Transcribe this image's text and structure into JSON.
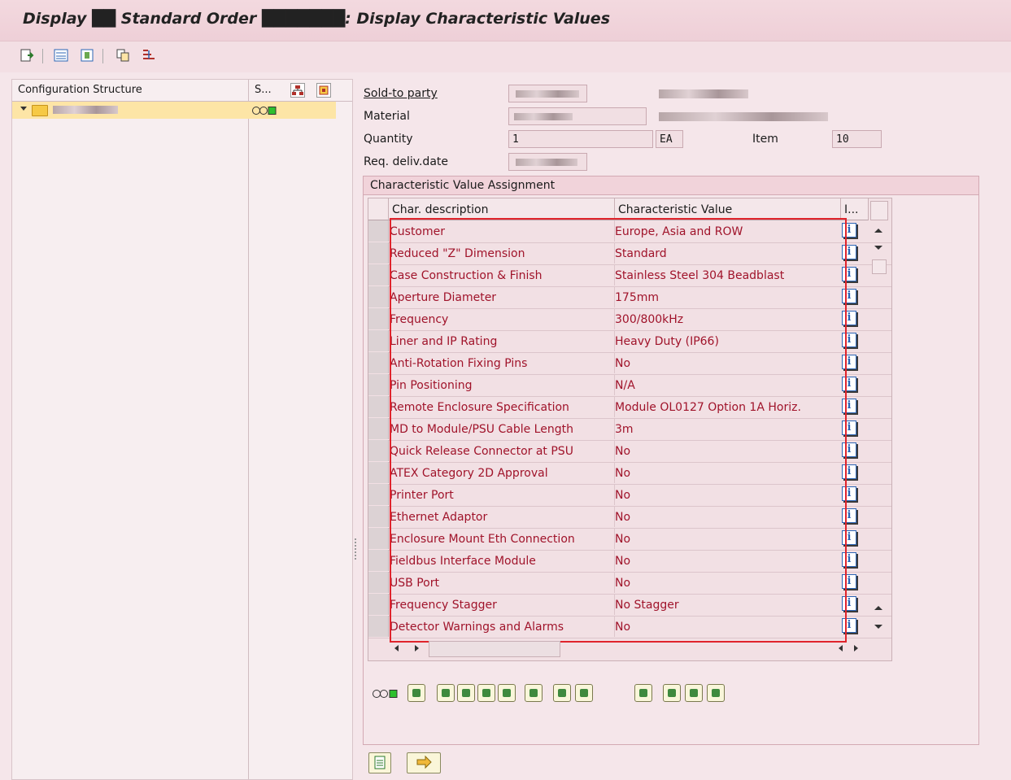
{
  "window": {
    "title": "Display ██ Standard Order ███████: Display Characteristic Values"
  },
  "toolbar": {
    "icons": [
      "new-document-icon",
      "expand-all-icon",
      "collapse-icon",
      "copy-icon",
      "hierarchy-icon"
    ]
  },
  "tree": {
    "col1": "Configuration Structure",
    "col2": "S...",
    "root_status": "OO■"
  },
  "header": {
    "sold_to_label": "Sold-to party",
    "material_label": "Material",
    "quantity_label": "Quantity",
    "quantity_value": "1",
    "uom_value": "EA",
    "item_label": "Item",
    "item_value": "10",
    "reqdate_label": "Req. deliv.date"
  },
  "group": {
    "title": "Characteristic Value Assignment"
  },
  "table": {
    "col_desc": "Char. description",
    "col_value": "Characteristic Value",
    "col_info": "I...",
    "rows": [
      {
        "desc": "Customer",
        "value": "Europe, Asia and ROW"
      },
      {
        "desc": "Reduced \"Z\" Dimension",
        "value": "Standard"
      },
      {
        "desc": "Case Construction & Finish",
        "value": "Stainless Steel 304 Beadblast"
      },
      {
        "desc": "Aperture Diameter",
        "value": "175mm"
      },
      {
        "desc": "Frequency",
        "value": "300/800kHz"
      },
      {
        "desc": "Liner and IP Rating",
        "value": "Heavy Duty (IP66)"
      },
      {
        "desc": "Anti-Rotation Fixing Pins",
        "value": "No"
      },
      {
        "desc": "Pin Positioning",
        "value": "N/A"
      },
      {
        "desc": "Remote Enclosure Specification",
        "value": "Module OL0127 Option 1A Horiz."
      },
      {
        "desc": "MD to Module/PSU Cable Length",
        "value": "3m"
      },
      {
        "desc": "Quick Release Connector at PSU",
        "value": "No"
      },
      {
        "desc": "ATEX Category 2D Approval",
        "value": "No"
      },
      {
        "desc": "Printer Port",
        "value": "No"
      },
      {
        "desc": "Ethernet Adaptor",
        "value": "No"
      },
      {
        "desc": "Enclosure Mount Eth Connection",
        "value": "No"
      },
      {
        "desc": "Fieldbus Interface Module",
        "value": "No"
      },
      {
        "desc": "USB Port",
        "value": "No"
      },
      {
        "desc": "Frequency Stagger",
        "value": "No Stagger"
      },
      {
        "desc": "Detector Warnings and Alarms",
        "value": "No"
      }
    ]
  },
  "status_indicator": "OO■",
  "colors": {
    "accent_red": "#a0132a",
    "highlight_border": "#e0242c",
    "tree_selected": "#fde5a6"
  }
}
